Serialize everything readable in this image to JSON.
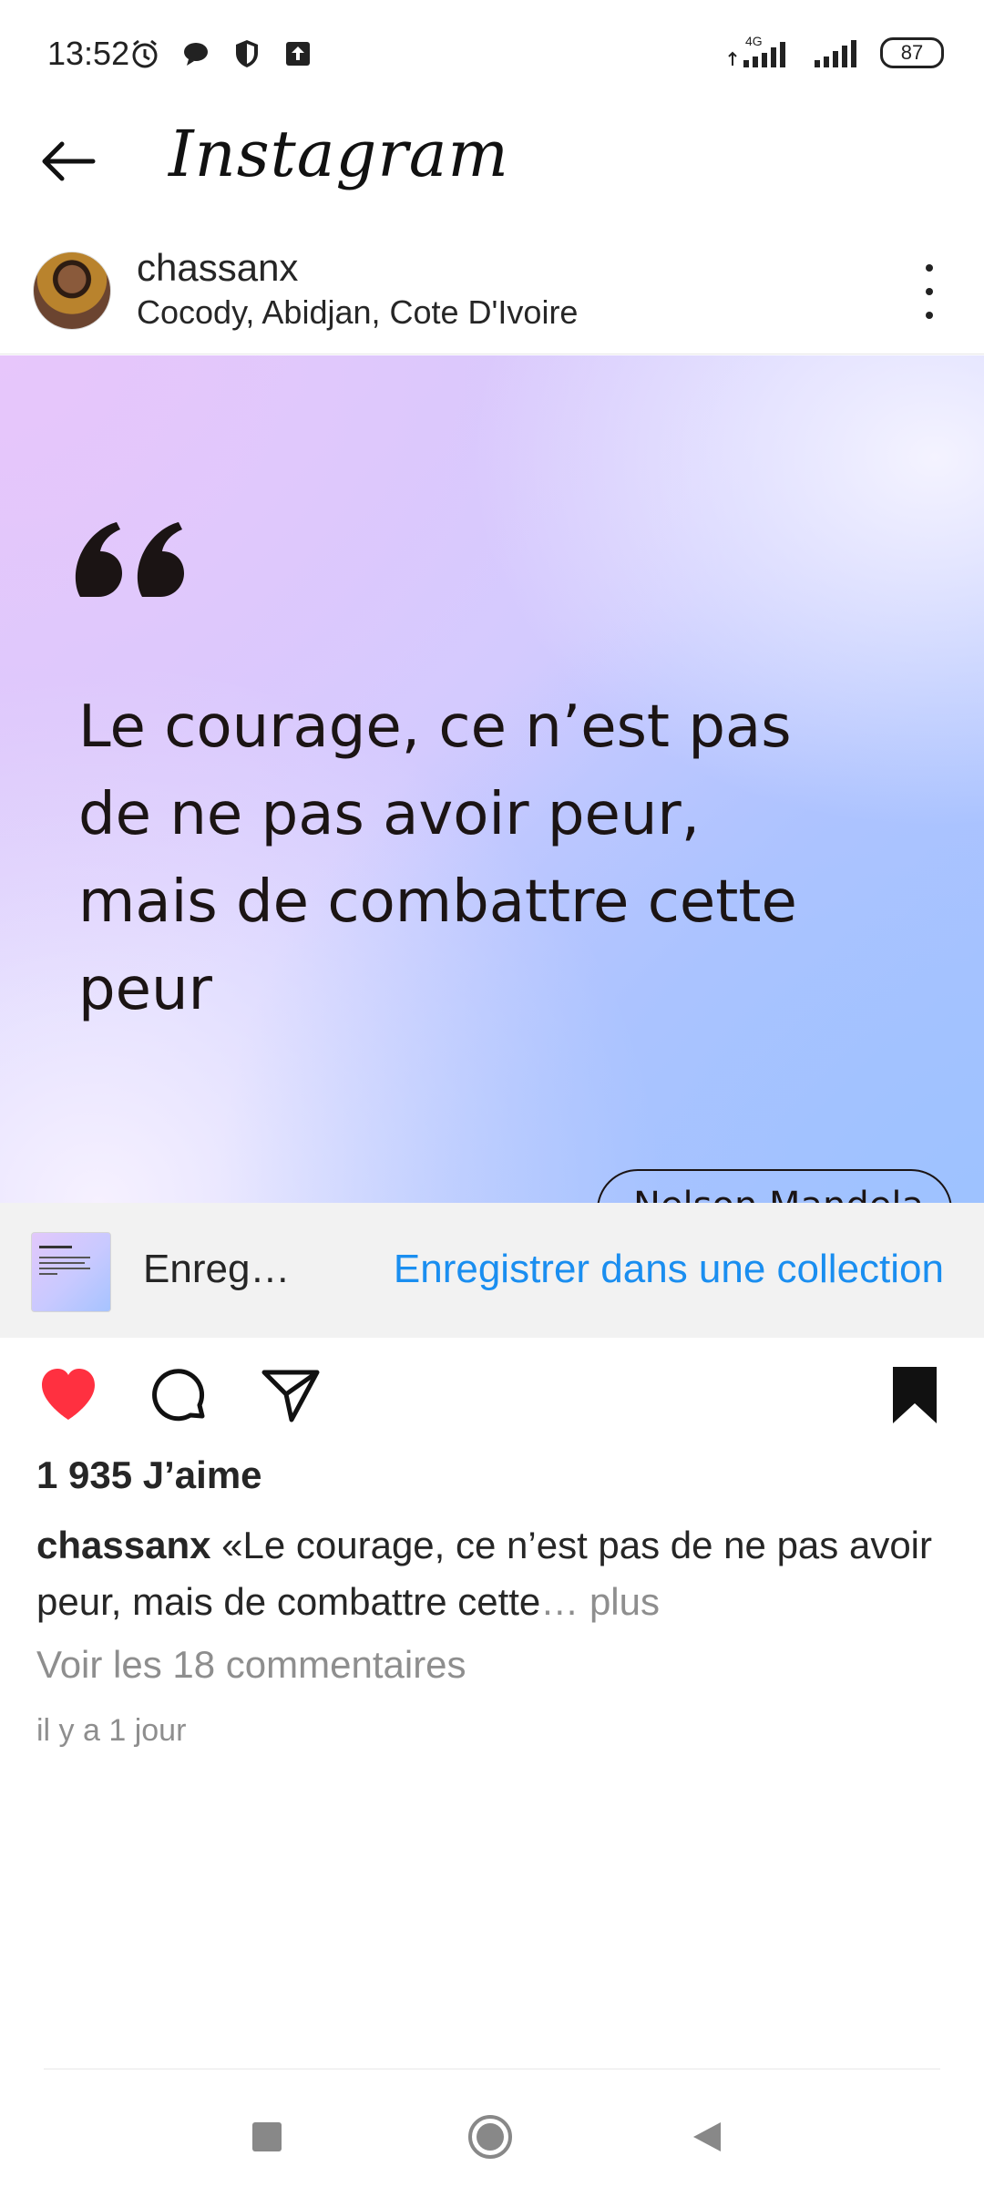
{
  "status_bar": {
    "time": "13:52",
    "network": "4G",
    "battery": "87",
    "icons": [
      "alarm-icon",
      "chat-bubble-icon",
      "shield-icon",
      "upload-icon",
      "signal-icon",
      "signal-icon"
    ]
  },
  "app": {
    "title": "Instagram"
  },
  "post": {
    "username": "chassanx",
    "location": "Cocody, Abidjan, Cote D'Ivoire",
    "image": {
      "quote_lines": [
        "Le courage, ce n’est pas",
        "de ne pas avoir peur,",
        "mais de combattre cette",
        "peur"
      ],
      "author": "Nelson Mandela"
    },
    "save_bar": {
      "label": "Enreg…",
      "link": "Enregistrer dans une collection"
    },
    "likes": "1 935 J’aime",
    "caption_user": "chassanx",
    "caption_text": "«Le courage, ce n’est pas de ne pas avoir peur, mais de combattre cette",
    "caption_more": "… plus",
    "view_comments": "Voir les 18 commentaires",
    "timestamp": "il y a 1 jour"
  },
  "colors": {
    "like_red": "#ff3040",
    "link_blue": "#1a8ef0",
    "muted_gray": "#8e8e8e",
    "text": "#262626"
  }
}
